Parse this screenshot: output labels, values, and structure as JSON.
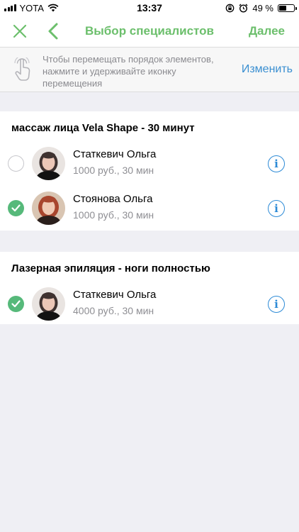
{
  "status_bar": {
    "carrier": "YOTA",
    "time": "13:37",
    "battery": "49 %",
    "battery_level": 0.49,
    "icons": [
      "signal-icon",
      "wifi-icon",
      "rotation-lock-icon",
      "alarm-icon",
      "battery-icon"
    ]
  },
  "nav": {
    "title": "Выбор специалистов",
    "next_label": "Далее",
    "accent_color": "#6cbf6c"
  },
  "hint": {
    "text": "Чтобы перемещать порядок элементов, нажмите и удерживайте иконку перемещения",
    "action_label": "Изменить",
    "action_color": "#3a8fd1"
  },
  "sections": [
    {
      "title": "массаж лица Vela Shape - 30 минут",
      "specialists": [
        {
          "name": "Статкевич Ольга",
          "details": "1000 руб., 30 мин",
          "selected": false
        },
        {
          "name": "Стоянова Ольга",
          "details": "1000 руб., 30 мин",
          "selected": true
        }
      ]
    },
    {
      "title": "Лазерная эпиляция - ноги полностью",
      "specialists": [
        {
          "name": "Статкевич Ольга",
          "details": "4000 руб., 30 мин",
          "selected": true
        }
      ]
    }
  ],
  "info_glyph": "i",
  "check_color": "#56b97a"
}
